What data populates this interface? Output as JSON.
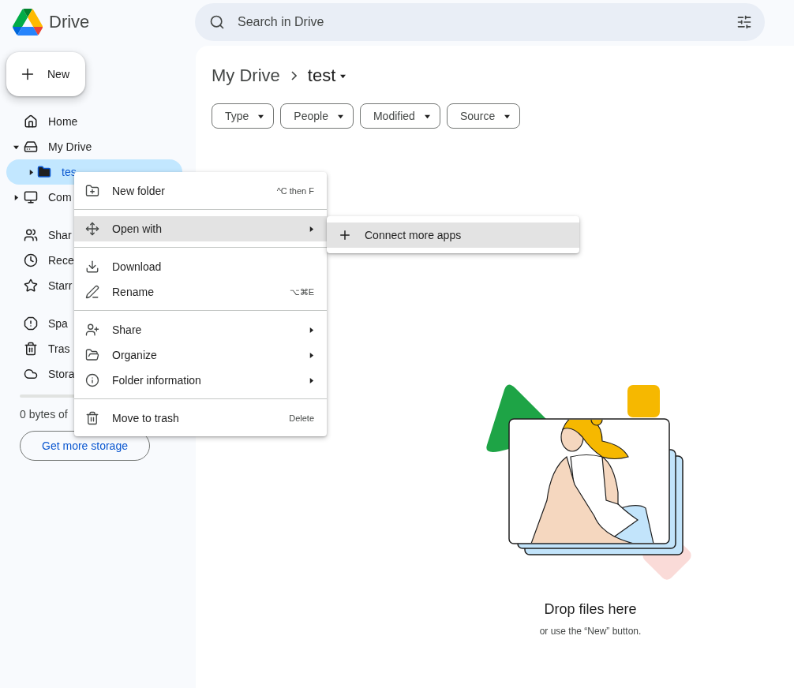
{
  "app": {
    "name": "Drive"
  },
  "search": {
    "placeholder": "Search in Drive"
  },
  "new_button": {
    "label": "New"
  },
  "sidebar": {
    "sections": [
      {
        "items": [
          {
            "label": "Home",
            "selected": false
          },
          {
            "label": "My Drive",
            "selected": false,
            "expanded": true,
            "children": [
              {
                "label": "tes",
                "selected": true,
                "expanded": false
              }
            ]
          },
          {
            "label": "Com",
            "selected": false,
            "expanded": false
          }
        ]
      },
      {
        "items": [
          {
            "label": "Shar",
            "selected": false
          },
          {
            "label": "Rece",
            "selected": false
          },
          {
            "label": "Starr",
            "selected": false
          }
        ]
      },
      {
        "items": [
          {
            "label": "Spa",
            "selected": false
          },
          {
            "label": "Tras",
            "selected": false
          },
          {
            "label": "Stora",
            "selected": false
          }
        ]
      }
    ],
    "storage": {
      "level": 0,
      "text": "0 bytes of",
      "button": "Get more storage"
    }
  },
  "breadcrumb": [
    {
      "label": "My Drive"
    },
    {
      "label": "test"
    }
  ],
  "filters": [
    "Type",
    "People",
    "Modified",
    "Source"
  ],
  "empty_state": {
    "title": "Drop files here",
    "subtitle": "or use the “New” button."
  },
  "context_menu": {
    "groups": [
      [
        {
          "label": "New folder",
          "shortcut": "^C then F",
          "submenu": false,
          "selected": false
        }
      ],
      [
        {
          "label": "Open with",
          "submenu": true,
          "selected": true
        }
      ],
      [
        {
          "label": "Download",
          "submenu": false,
          "selected": false
        },
        {
          "label": "Rename",
          "shortcut": "⌥⌘E",
          "submenu": false,
          "selected": false
        }
      ],
      [
        {
          "label": "Share",
          "submenu": true,
          "selected": false
        },
        {
          "label": "Organize",
          "submenu": true,
          "selected": false
        },
        {
          "label": "Folder information",
          "submenu": true,
          "selected": false
        }
      ],
      [
        {
          "label": "Move to trash",
          "shortcut": "Delete",
          "submenu": false,
          "selected": false
        }
      ]
    ]
  },
  "submenu": {
    "items": [
      {
        "label": "Connect more apps",
        "selected": true
      }
    ]
  }
}
